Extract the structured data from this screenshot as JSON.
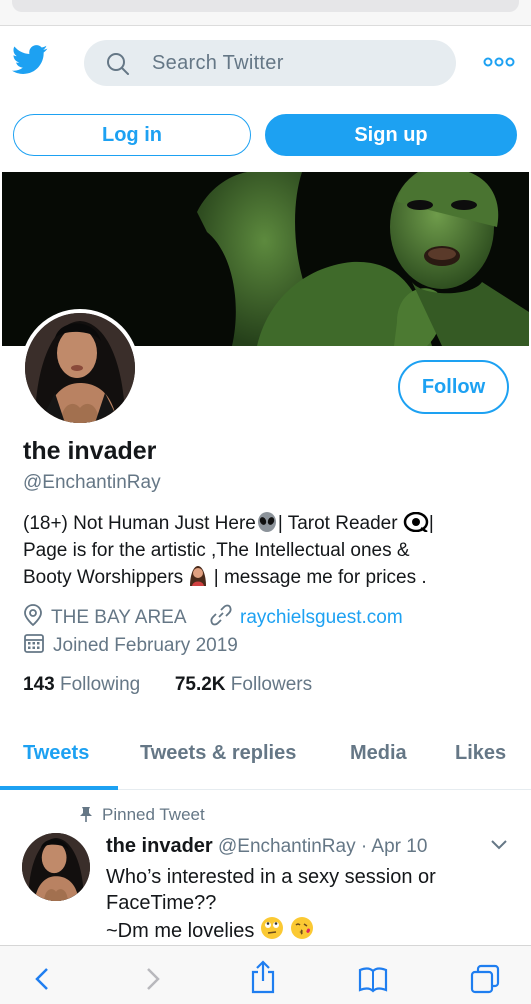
{
  "header": {
    "search_placeholder": "Search Twitter"
  },
  "auth": {
    "login_label": "Log in",
    "signup_label": "Sign up"
  },
  "profile": {
    "follow_label": "Follow",
    "name": "the invader",
    "handle": "@EnchantinRay",
    "bio_line1_a": "(18+) Not Human Just Here",
    "bio_line1_b": "| Tarot Reader",
    "bio_line1_c": "|",
    "bio_line2": "Page is for the artistic ,The Intellectual ones &",
    "bio_line3_a": "Booty Worshippers",
    "bio_line3_b": "| message me for prices .",
    "location": "THE BAY AREA",
    "website": "raychielsguest.com",
    "joined": "Joined February 2019",
    "following_count": "143",
    "following_label": "Following",
    "followers_count": "75.2K",
    "followers_label": "Followers"
  },
  "tabs": [
    {
      "label": "Tweets"
    },
    {
      "label": "Tweets & replies"
    },
    {
      "label": "Media"
    },
    {
      "label": "Likes"
    }
  ],
  "pinned_tweet": {
    "pinned_label": "Pinned Tweet",
    "name": "the invader",
    "handle": "@EnchantinRay",
    "separator": "·",
    "date": "Apr 10",
    "line1": "Who’s interested in a sexy session or",
    "line2": "FaceTime??",
    "line3": "~Dm me lovelies"
  },
  "icons": [
    "twitter-bird-icon",
    "search-icon",
    "more-icon",
    "alien-emoji-icon",
    "eye-emoji-icon",
    "woman-emoji-icon",
    "location-icon",
    "link-icon",
    "calendar-icon",
    "pin-icon",
    "chevron-down-icon",
    "back-icon",
    "forward-icon",
    "share-icon",
    "bookmarks-icon",
    "tabs-icon"
  ],
  "colors": {
    "accent": "#1da1f2",
    "secondary_text": "#657786",
    "primary_text": "#14171a"
  }
}
